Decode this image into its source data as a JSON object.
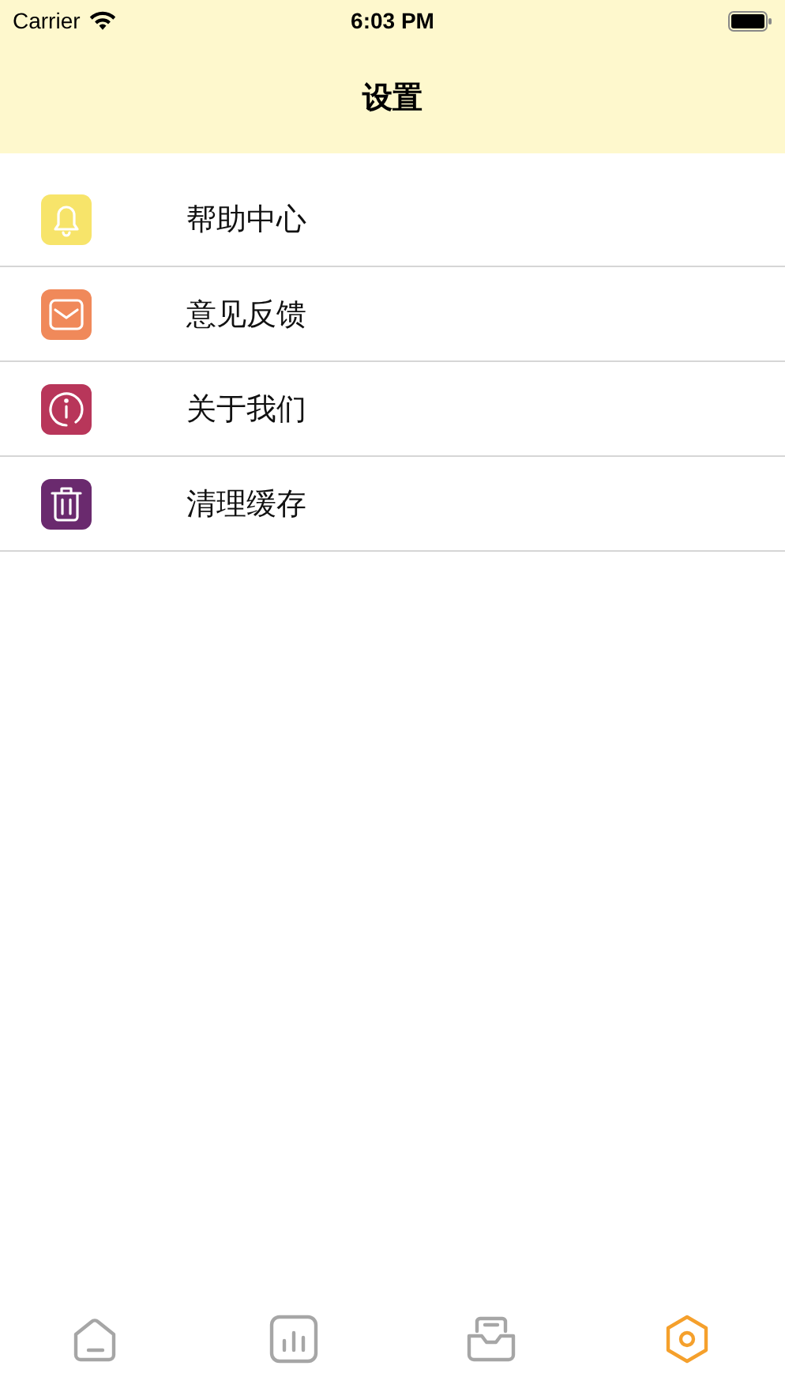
{
  "status_bar": {
    "carrier": "Carrier",
    "time": "6:03 PM"
  },
  "nav": {
    "title": "设置"
  },
  "items": [
    {
      "label": "帮助中心",
      "kind": "bell",
      "color": "#f7e46a"
    },
    {
      "label": "意见反馈",
      "kind": "mail",
      "color": "#f0895a"
    },
    {
      "label": "关于我们",
      "kind": "info",
      "color": "#b8365a"
    },
    {
      "label": "清理缓存",
      "kind": "trash",
      "color": "#6a2a6e"
    }
  ],
  "tabs": [
    {
      "kind": "home",
      "selected": false
    },
    {
      "kind": "chart",
      "selected": false
    },
    {
      "kind": "inbox",
      "selected": false
    },
    {
      "kind": "settings",
      "selected": true
    }
  ]
}
